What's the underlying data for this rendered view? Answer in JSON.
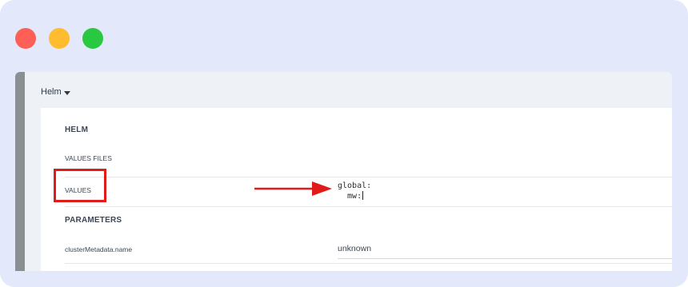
{
  "window": {
    "controls": [
      {
        "name": "close",
        "color": "#fe5f57"
      },
      {
        "name": "minimize",
        "color": "#febc2e"
      },
      {
        "name": "maximize",
        "color": "#28c840"
      }
    ]
  },
  "header": {
    "menu_label": "Helm",
    "caret_icon": "caret-down-icon"
  },
  "helm": {
    "section_title": "HELM",
    "values_files_label": "VALUES FILES",
    "values_label": "VALUES",
    "values_lines": [
      "global:",
      "  mw:"
    ]
  },
  "parameters": {
    "section_title": "PARAMETERS",
    "rows": [
      {
        "name": "clusterMetadata.name",
        "value": "unknown"
      }
    ]
  },
  "annotation": {
    "color": "#e11a1a",
    "arrow_icon": "arrow-right-icon"
  }
}
